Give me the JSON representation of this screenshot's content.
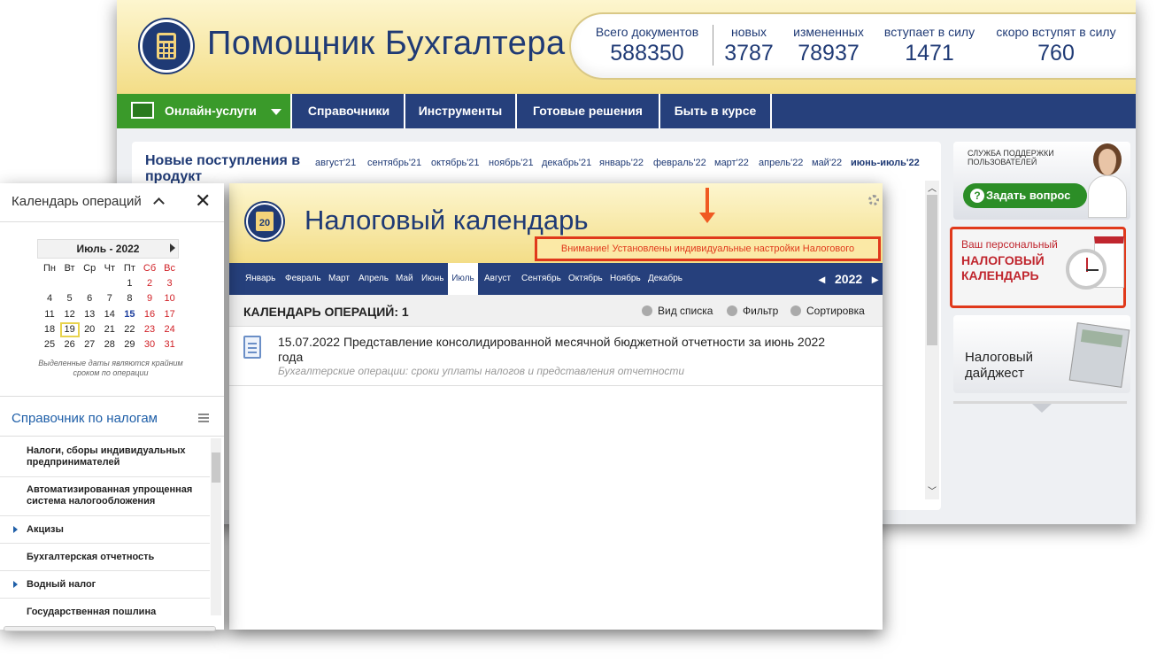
{
  "header": {
    "app_title": "Помощник Бухгалтера"
  },
  "stats": [
    {
      "label": "Всего документов",
      "value": "588350"
    },
    {
      "label": "новых",
      "value": "3787"
    },
    {
      "label": "измененных",
      "value": "78937"
    },
    {
      "label": "вступает в силу",
      "value": "1471"
    },
    {
      "label": "скоро вступят в силу",
      "value": "760"
    }
  ],
  "nav": [
    "Онлайн-услуги",
    "Справочники",
    "Инструменты",
    "Готовые решения",
    "Быть в курсе"
  ],
  "new_arrivals": {
    "title": "Новые поступления в продукт",
    "months": [
      "август'21",
      "сентябрь'21",
      "октябрь'21",
      "ноябрь'21",
      "декабрь'21",
      "январь'22",
      "февраль'22",
      "март'22",
      "апрель'22",
      "май'22",
      "июнь-июль'22"
    ]
  },
  "sidebar": {
    "support_text": "СЛУЖБА ПОДДЕРЖКИ ПОЛЬЗОВАТЕЛЕЙ",
    "ask_button": "Задать вопрос",
    "taxcal_line1": "Ваш персональный",
    "taxcal_line2": "НАЛОГОВЫЙ КАЛЕНДАРЬ",
    "digest": "Налоговый дайджест"
  },
  "taxcal": {
    "title": "Налоговый календарь",
    "warning": "Внимание! Установлены индивидуальные настройки Налогового календаря",
    "months": [
      "Январь",
      "Февраль",
      "Март",
      "Апрель",
      "Май",
      "Июнь",
      "Июль",
      "Август",
      "Сентябрь",
      "Октябрь",
      "Ноябрь",
      "Декабрь"
    ],
    "selected_month": "Июль",
    "year": "2022",
    "list_title": "КАЛЕНДАРЬ ОПЕРАЦИЙ: 1",
    "tools": [
      "Вид списка",
      "Фильтр",
      "Сортировка"
    ],
    "operation": {
      "title": "15.07.2022 Представление консолидированной месячной бюджетной отчетности за июнь 2022 года",
      "subtitle": "Бухгалтерские операции: сроки уплаты налогов и представления отчетности"
    }
  },
  "leftpanel": {
    "title": "Календарь операций",
    "cal_header": "Июль - 2022",
    "weekdays": [
      "Пн",
      "Вт",
      "Ср",
      "Чт",
      "Пт",
      "Сб",
      "Вс"
    ],
    "weeks": [
      [
        "",
        "",
        "",
        "",
        "1",
        "2",
        "3"
      ],
      [
        "4",
        "5",
        "6",
        "7",
        "8",
        "9",
        "10"
      ],
      [
        "11",
        "12",
        "13",
        "14",
        "15",
        "16",
        "17"
      ],
      [
        "18",
        "19",
        "20",
        "21",
        "22",
        "23",
        "24"
      ],
      [
        "25",
        "26",
        "27",
        "28",
        "29",
        "30",
        "31"
      ]
    ],
    "note": "Выделенные даты являются крайним сроком по операции",
    "sprav_title": "Справочник по налогам",
    "items": [
      "Налоги, сборы индивидуальных предпринимателей",
      "Автоматизированная упрощенная система налогообложения",
      "Акцизы",
      "Бухгалтерская отчетность",
      "Водный налог",
      "Государственная пошлина"
    ]
  },
  "colors": {
    "navy": "#26407c",
    "green": "#3a9a2a",
    "red": "#e0391b",
    "gold": "#f3dd87"
  }
}
